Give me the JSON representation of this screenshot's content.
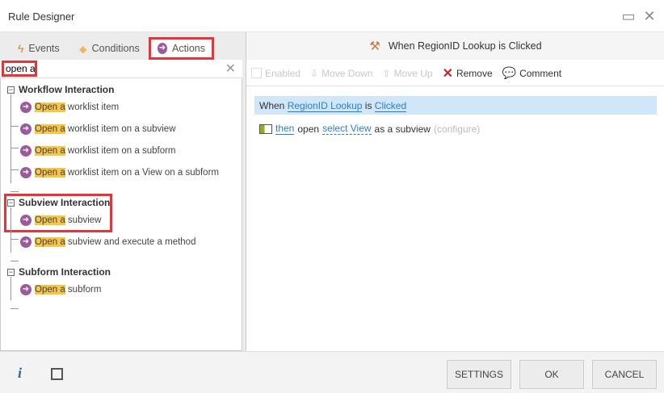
{
  "window": {
    "title": "Rule Designer"
  },
  "tabs": [
    {
      "label": "Events"
    },
    {
      "label": "Conditions"
    },
    {
      "label": "Actions"
    }
  ],
  "search": {
    "value": "open a"
  },
  "groups": [
    {
      "label": "Workflow Interaction",
      "items": [
        {
          "match": "Open a",
          "rest": " worklist item"
        },
        {
          "match": "Open a",
          "rest": " worklist item on a subview"
        },
        {
          "match": "Open a",
          "rest": " worklist item on a subform"
        },
        {
          "match": "Open a",
          "rest": " worklist item on a View on a subform"
        }
      ]
    },
    {
      "label": "Subview Interaction",
      "items": [
        {
          "match": "Open a",
          "rest": " subview"
        },
        {
          "match": "Open a",
          "rest": " subview and execute a method"
        }
      ]
    },
    {
      "label": "Subform Interaction",
      "items": [
        {
          "match": "Open a",
          "rest": " subform"
        }
      ]
    }
  ],
  "rule": {
    "header": "When RegionID Lookup is Clicked",
    "toolbar": {
      "enabled": "Enabled",
      "move_down": "Move Down",
      "move_up": "Move Up",
      "remove": "Remove",
      "comment": "Comment"
    },
    "when": {
      "w": "When",
      "control": "RegionID Lookup",
      "is": "is",
      "event": "Clicked"
    },
    "then": {
      "then": "then",
      "open": "open",
      "view": "select View",
      "as": "as a subview",
      "configure": "(configure)"
    }
  },
  "footer": {
    "settings": "SETTINGS",
    "ok": "OK",
    "cancel": "CANCEL"
  }
}
